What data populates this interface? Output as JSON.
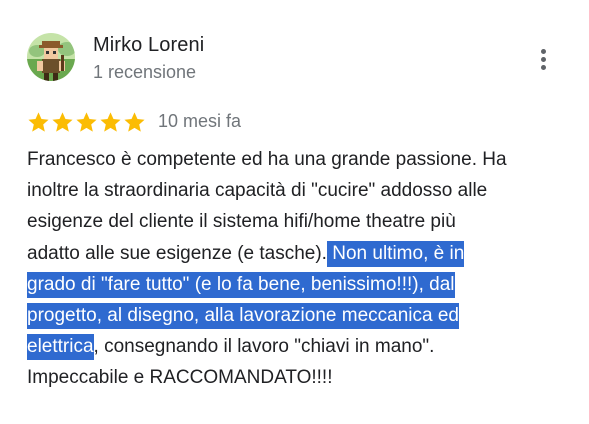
{
  "author": {
    "name": "Mirko Loreni",
    "meta": "1 recensione"
  },
  "more_menu": {
    "icon": "more-vertical-icon"
  },
  "rating": {
    "stars": 5,
    "max_stars": 5,
    "star_color": "#fbbc04",
    "date": "10 mesi fa"
  },
  "review": {
    "line1": "Francesco è competente ed ha una grande passione. Ha",
    "line2": "inoltre la straordinaria capacità di \"cucire\" addosso alle",
    "line3": "esigenze del cliente il sistema hifi/home theatre più",
    "line4_plain": "adatto alle sue esigenze (e tasche).",
    "line4_selected": " Non ultimo, è in",
    "line5_selected": "grado di \"fare tutto\" (e lo fa bene, benissimo!!!), dal",
    "line6_selected": "progetto, al disegno, alla lavorazione meccanica ed",
    "line7_selected": "elettrica",
    "line7_plain": ", consegnando il lavoro \"chiavi in mano\".",
    "line8": "Impeccabile e RACCOMANDATO!!!!",
    "selection_color": "#2f6ad0"
  }
}
